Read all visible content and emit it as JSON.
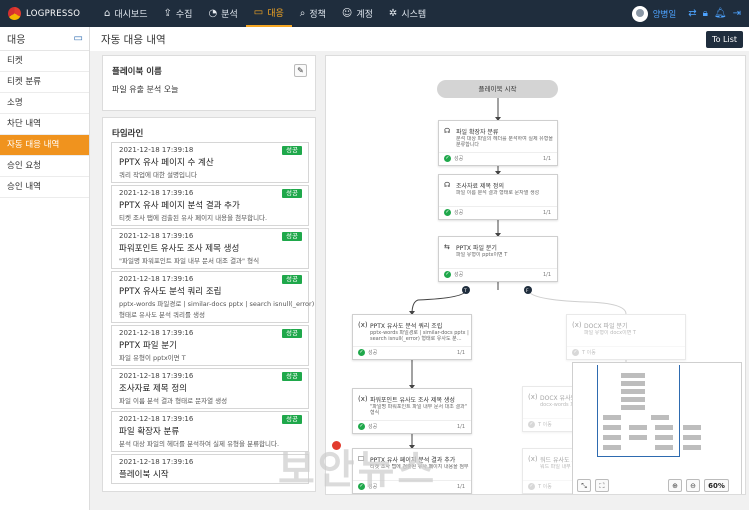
{
  "app": {
    "brand": "LOGPRESSO",
    "logo_icon": "logpresso-logo-icon"
  },
  "nav": {
    "items": [
      {
        "label": "대시보드",
        "icon": "dashboard-icon",
        "glyph": "⌂"
      },
      {
        "label": "수집",
        "icon": "upload-icon",
        "glyph": "⇪"
      },
      {
        "label": "분석",
        "icon": "pie-chart-icon",
        "glyph": "◔"
      },
      {
        "label": "대응",
        "icon": "monitor-icon",
        "glyph": "▭",
        "active": true
      },
      {
        "label": "정책",
        "icon": "search-icon",
        "glyph": "⌕"
      },
      {
        "label": "계정",
        "icon": "user-circle-icon",
        "glyph": "☺"
      },
      {
        "label": "시스템",
        "icon": "gear-icon",
        "glyph": "✲"
      }
    ],
    "user_name": "양병일"
  },
  "sidebar": {
    "title": "대응",
    "items": [
      "티켓",
      "티켓 분류",
      "소명",
      "차단 내역",
      "자동 대응 내역",
      "승인 요청",
      "승인 내역"
    ],
    "active_index": 4
  },
  "content": {
    "title": "자동 대응 내역",
    "to_list_label": "To List"
  },
  "playbook": {
    "title": "플레이북 이름",
    "value": "파일 유출 분석 오늘"
  },
  "timeline": {
    "title": "타임라인",
    "events": [
      {
        "time": "2021-12-18 17:39:18",
        "badge": "성공",
        "event": "PPTX 유사 페이지 수 계산",
        "desc": [
          "쿼리 작업에 대한 설명입니다"
        ]
      },
      {
        "time": "2021-12-18 17:39:16",
        "badge": "성공",
        "event": "PPTX 유사 페이지 분석 결과 추가",
        "desc": [
          "티켓 조사 탭에 검출된 유사 페이지 내용을 첨부합니다."
        ]
      },
      {
        "time": "2021-12-18 17:39:16",
        "badge": "성공",
        "event": "파워포인트 유사도 조사 제목 생성",
        "desc": [
          "\"파일명 파워포인트 파일 내부 문서 대조 결과\" 형식"
        ]
      },
      {
        "time": "2021-12-18 17:39:16",
        "badge": "성공",
        "event": "PPTX 유사도 분석 쿼리 조립",
        "desc": [
          "pptx-words 파일경로 | similar-docs pptx | search isnull(_error)",
          "형태로 유사도 분석 쿼리를 생성"
        ]
      },
      {
        "time": "2021-12-18 17:39:16",
        "badge": "성공",
        "event": "PPTX 파일 분기",
        "desc": [
          "파일 유형이 pptx이면 T"
        ]
      },
      {
        "time": "2021-12-18 17:39:16",
        "badge": "성공",
        "event": "조사자료 제목 정의",
        "desc": [
          "파일 이름 분석 결과 형태로 문자열 생성"
        ]
      },
      {
        "time": "2021-12-18 17:39:16",
        "badge": "성공",
        "event": "파일 확장자 분류",
        "desc": [
          "분석 대상 파일의 헤더를 분석하여 실제 유형을 분류합니다."
        ]
      },
      {
        "time": "2021-12-18 17:39:16",
        "badge": "",
        "event": "플레이북 시작",
        "desc": []
      }
    ]
  },
  "flow": {
    "start_label": "플레이북 시작",
    "nodes": [
      {
        "icon": "☊",
        "title": "파일 확장자 분류",
        "desc": "분석 대상 파일의 헤더를 분석하여 실제 유형을 분류합니다",
        "status": "성공",
        "count": "1/1"
      },
      {
        "icon": "☊",
        "title": "조사자료 제목 정의",
        "desc": "파일 이름 분석 결과 형태로 문자열 생성",
        "status": "성공",
        "count": "1/1"
      },
      {
        "icon": "⇆",
        "title": "PPTX 파일 분기",
        "desc": "파일 유형이 pptx이면 T",
        "status": "성공",
        "count": "1/1"
      },
      {
        "icon": "(x)",
        "title": "PPTX 유사도 분석 쿼리 조립",
        "desc": "pptx-words 파일경로 | similar-docs pptx | search isnull(_error) 형태로 유사도 분...",
        "status": "성공",
        "count": "1/1"
      },
      {
        "icon": "(x)",
        "title": "DOCX 파일 분기",
        "desc": "파일 유형이 docx이면 T",
        "status": "T 이동",
        "count": "",
        "faded": true
      },
      {
        "icon": "(x)",
        "title": "파워포인트 유사도 조사 제목 생성",
        "desc": "\"파일명 파워포인트 파일 내부 문서 대조 결과\" 형식",
        "status": "성공",
        "count": "1/1"
      },
      {
        "icon": "(x)",
        "title": "DOCX 유사도 분석",
        "desc": "docx-words 파일경로 | similar-docs",
        "status": "T 이동",
        "count": "",
        "faded": true
      },
      {
        "icon": "☐",
        "title": "PPTX 유사 페이지 분석 결과 추가",
        "desc": "티켓 조사 탭에 검출된 유사 페이지 내용을 첨부",
        "status": "성공",
        "count": "1/1"
      },
      {
        "icon": "(x)",
        "title": "워드 유사도 조사 제목 생성",
        "desc": "워드 파일 내부 문서 대조 결과 형식",
        "status": "T 이동",
        "count": "",
        "faded": true
      }
    ],
    "branch_labels": [
      "T",
      "F"
    ],
    "zoom": "60%"
  },
  "watermark": "보안뉴스",
  "colors": {
    "nav_bg": "#1f2d3d",
    "accent": "#f0931e",
    "success": "#1fa84b",
    "link": "#4da3ff"
  }
}
